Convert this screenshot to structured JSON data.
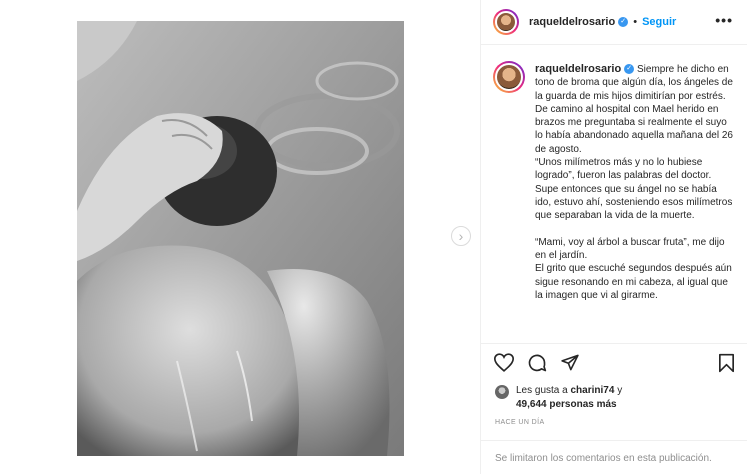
{
  "post": {
    "username": "raqueldelrosario",
    "follow_label": "Seguir",
    "dot": "•",
    "more_label": "•••",
    "caption": "Siempre he dicho en tono de broma que algún día, los ángeles de la guarda de mis hijos dimitirían por estrés.\nDe camino al hospital con Mael herido en brazos me preguntaba si realmente el suyo lo había abandonado aquella mañana del 26 de agosto.\n“Unos milímetros más y no lo hubiese logrado”, fueron las palabras del doctor.\nSupe entonces que su ángel no se había ido, estuvo ahí, sosteniendo esos milímetros que separaban la vida de la muerte.\n\n“Mami, voy al árbol a buscar fruta”, me dijo en el jardín.\nEl grito que escuché segundos después aún sigue resonando en mi cabeza, al igual que la imagen que vi al girarme.",
    "likes_prefix": "Les gusta a",
    "liked_by": "charini74",
    "likes_mid": "y",
    "likes_count": "49,644 personas más",
    "time_ago": "HACE UN DÍA",
    "comments_disabled": "Se limitaron los comentarios en esta publicación.",
    "next_arrow": "›"
  },
  "icons": {
    "heart": "heart-icon",
    "comment": "comment-icon",
    "share": "share-icon",
    "save": "bookmark-icon",
    "verified": "verified-badge-icon"
  },
  "colors": {
    "link": "#0095f6",
    "verified": "#3897f0",
    "muted": "#8e8e8e",
    "border": "#efefef"
  }
}
